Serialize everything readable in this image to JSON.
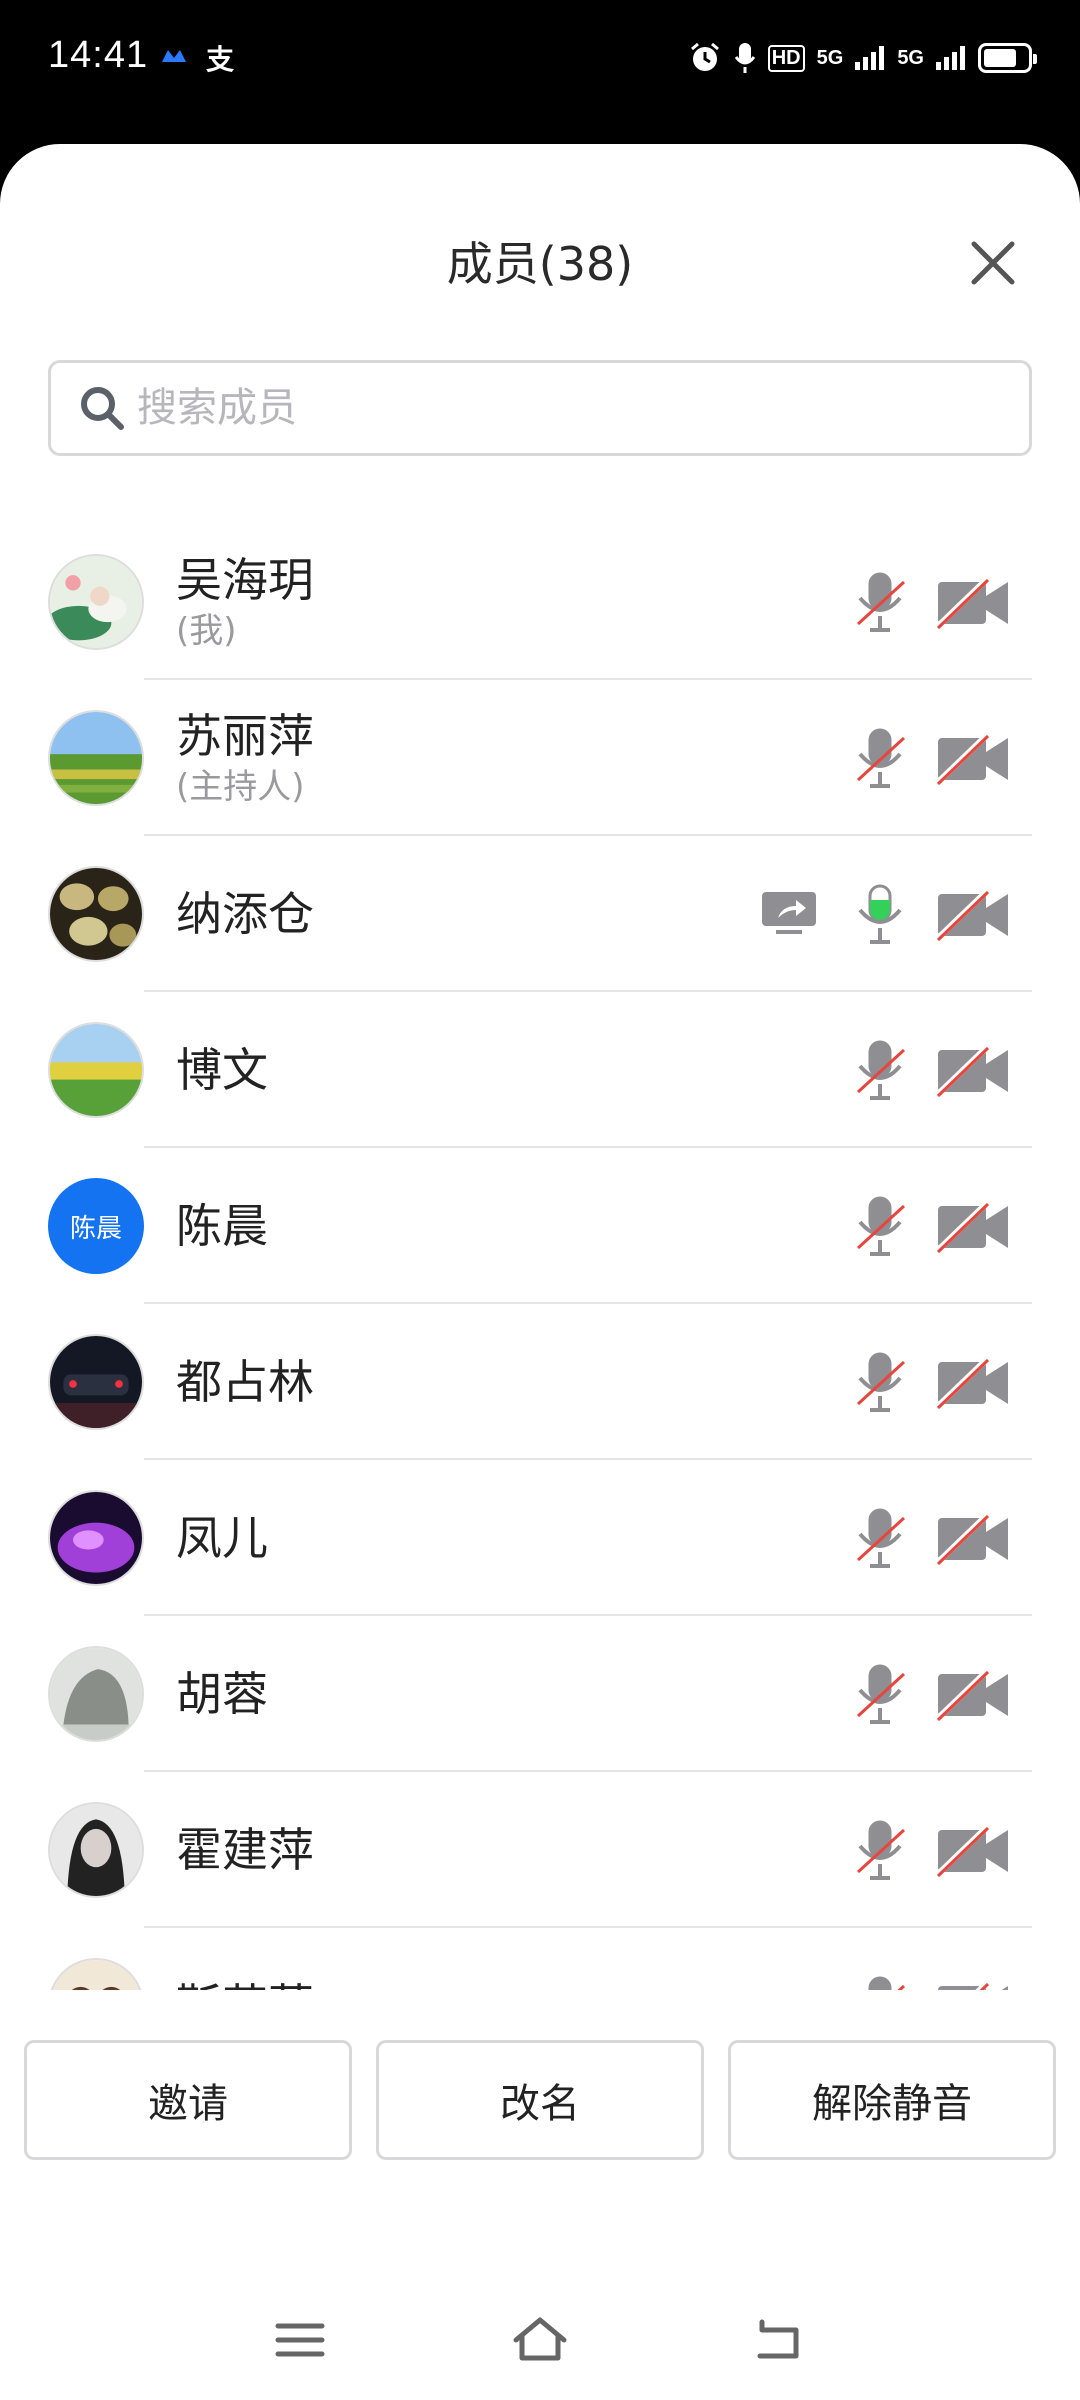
{
  "status_bar": {
    "time": "14:41",
    "app_icon_2": "支",
    "signal_1": "5G",
    "signal_2": "5G",
    "hd": "HD"
  },
  "header": {
    "title": "成员(38)"
  },
  "search": {
    "placeholder": "搜索成员"
  },
  "members": [
    {
      "name": "吴海玥",
      "sub": "(我)",
      "avatar": "photo-lotus",
      "mic": "muted",
      "camera": "off"
    },
    {
      "name": "苏丽萍",
      "sub": "(主持人)",
      "avatar": "photo-field",
      "mic": "muted",
      "camera": "off"
    },
    {
      "name": "纳添仓",
      "sub": "",
      "avatar": "photo-beans",
      "mic": "active",
      "camera": "off",
      "sharing": true
    },
    {
      "name": "博文",
      "sub": "",
      "avatar": "photo-meadow",
      "mic": "muted",
      "camera": "off"
    },
    {
      "name": "陈晨",
      "sub": "",
      "avatar_text": "陈晨",
      "mic": "muted",
      "camera": "off"
    },
    {
      "name": "都占林",
      "sub": "",
      "avatar": "photo-car",
      "mic": "muted",
      "camera": "off"
    },
    {
      "name": "凤儿",
      "sub": "",
      "avatar": "photo-purple",
      "mic": "muted",
      "camera": "off"
    },
    {
      "name": "胡蓉",
      "sub": "",
      "avatar": "photo-rock",
      "mic": "muted",
      "camera": "off"
    },
    {
      "name": "霍建萍",
      "sub": "",
      "avatar": "photo-portrait",
      "mic": "muted",
      "camera": "off"
    },
    {
      "name": "靳芷蔻",
      "sub": "",
      "avatar": "photo-cartoon",
      "mic": "muted",
      "camera": "off"
    }
  ],
  "actions": {
    "invite": "邀请",
    "rename": "改名",
    "unmute": "解除静音"
  },
  "colors": {
    "accent": "#1473f0",
    "muted_red": "#e8463c",
    "active_green": "#33d15a",
    "icon_gray": "#8e8e93"
  }
}
